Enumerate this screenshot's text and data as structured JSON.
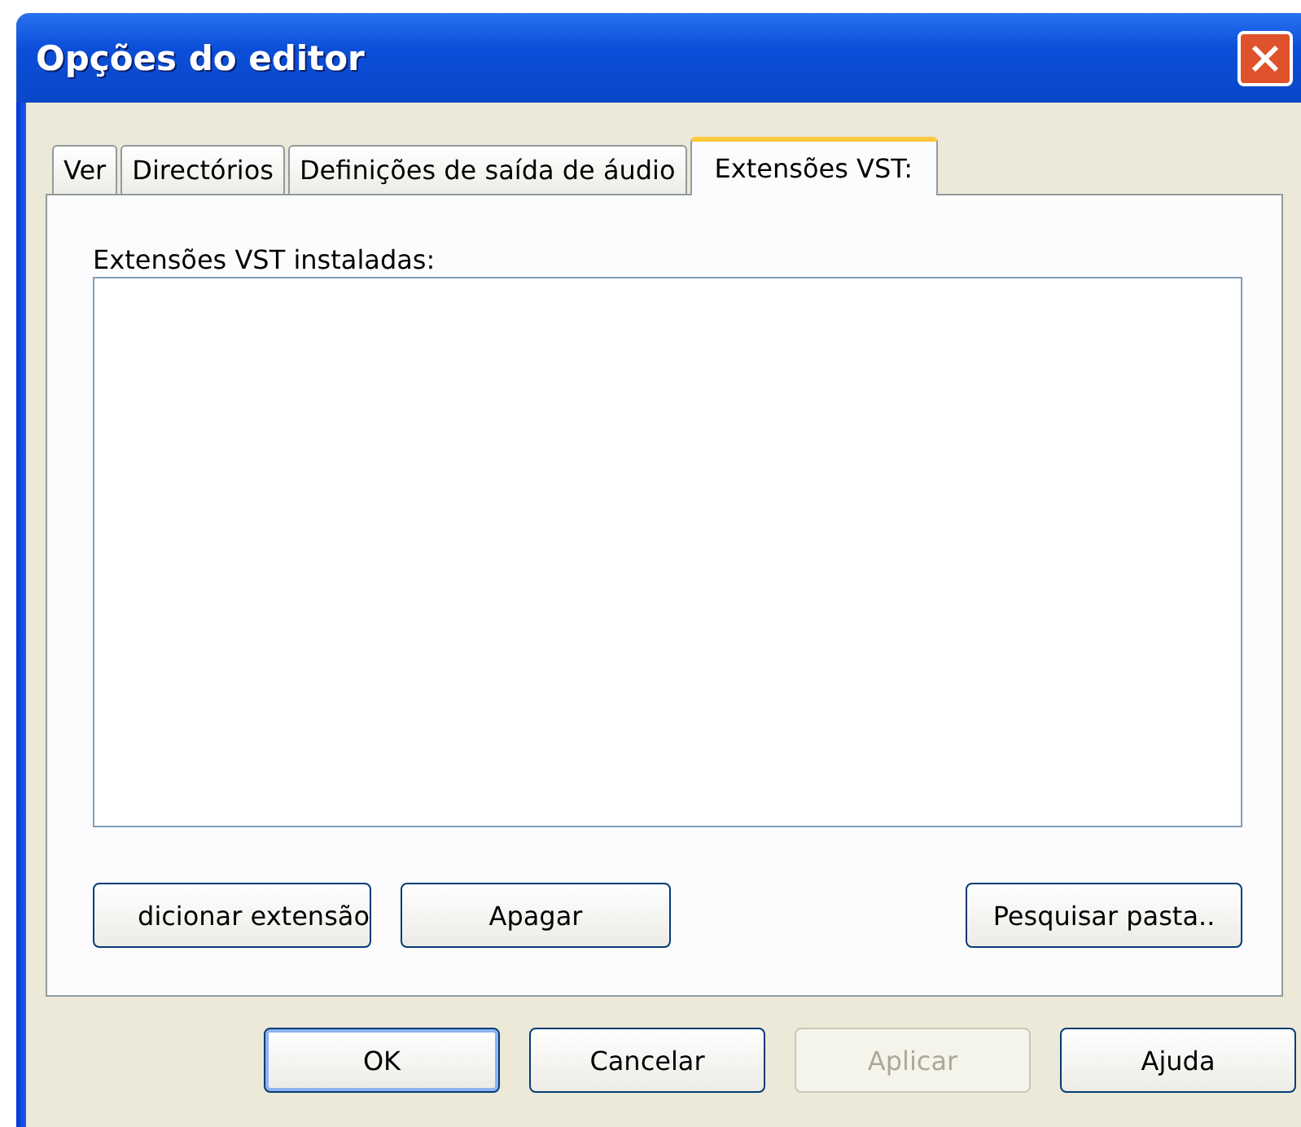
{
  "window": {
    "title": "Opções do editor"
  },
  "tabs": [
    {
      "label": "Ver",
      "selected": false
    },
    {
      "label": "Directórios",
      "selected": false
    },
    {
      "label": "Definições de saída de áudio",
      "selected": false
    },
    {
      "label": "Extensões VST:",
      "selected": true
    }
  ],
  "list_label": "Extensões VST instaladas:",
  "panel_buttons": [
    "dicionar extensão",
    "Apagar",
    "Pesquisar pasta.."
  ],
  "buttons": [
    {
      "label": "OK",
      "disabled": false,
      "default": true
    },
    {
      "label": "Cancelar",
      "disabled": false,
      "default": false
    },
    {
      "label": "Aplicar",
      "disabled": true,
      "default": false
    },
    {
      "label": "Ajuda",
      "disabled": false,
      "default": false
    }
  ]
}
